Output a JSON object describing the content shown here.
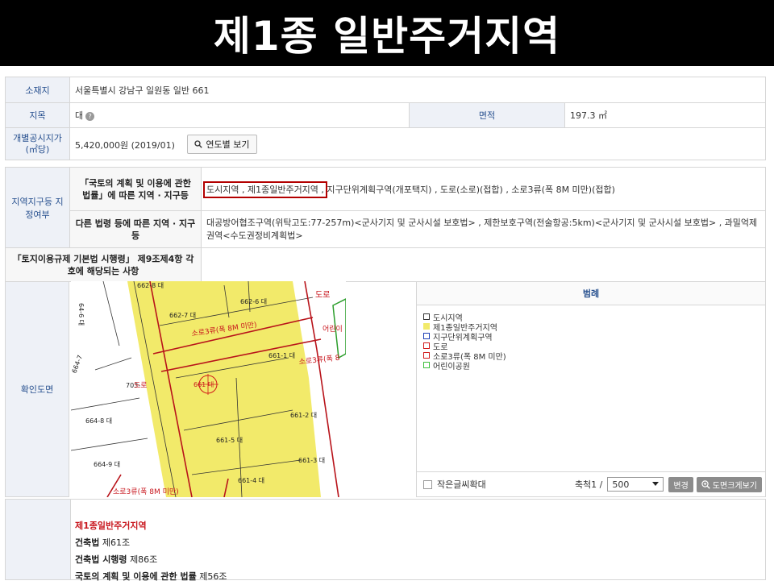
{
  "page": {
    "title": "제1종 일반주거지역"
  },
  "info": {
    "location_label": "소재지",
    "location_value": "서울특별시 강남구 일원동 일반 661",
    "jimok_label": "지목",
    "jimok_value": "대",
    "area_label": "면적",
    "area_value": "197.3 ㎡",
    "price_label": "개별공시지가(㎡당)",
    "price_value": "5,420,000원 (2019/01)",
    "price_button": "연도별 보기",
    "zone_label": "지역지구등 지정여부",
    "national_law_label": "「국토의 계획 및 이용에 관한 법률」에 따른 지역 · 지구등",
    "national_law_highlight": "도시지역 , 제1종일반주거지역 ,",
    "national_law_rest": "지구단위계획구역(개포택지) , 도로(소로)(접합) , 소로3류(폭 8M 미만)(접합)",
    "other_law_label": "다른 법령 등에 따른 지역 · 지구등",
    "other_law_value": "대공방어협조구역(위탁고도:77-257m)<군사기지 및 군사시설 보호법> , 제한보호구역(전술항공:5km)<군사기지 및 군사시설 보호법> , 과밀억제권역<수도권정비계획법>",
    "regulation_label": "「토지이용규제 기본법 시행령」 제9조제4항 각 호에 해당되는 사항",
    "regulation_value": ""
  },
  "map": {
    "section_label": "확인도면",
    "labels": {
      "p6628": "662-8 대",
      "p6627": "662-7 대",
      "p6626": "662-6 대",
      "road_top": "도로",
      "road_small1": "소로3류(폭 8M 미만)",
      "child_park": "어린이",
      "p6611": "661-1 대",
      "road_small2": "소로3류(폭 8",
      "p6647": "664-7",
      "p703": "703-",
      "road_do": "도로",
      "center": "661 대",
      "p6612": "661-2 대",
      "p6648": "664-8 대",
      "p6615": "661-5 대",
      "p6649": "664-9 대",
      "p6613": "661-3 대",
      "p6614": "661-4 대",
      "road_bottom": "소로3류(폭 8M 미만)",
      "side_64": "64-6 대"
    }
  },
  "legend": {
    "title": "범례",
    "items": [
      {
        "label": "도시지역",
        "color": "#ffffff",
        "border": "#333333"
      },
      {
        "label": "제1종일반주거지역",
        "color": "#f2ea6a",
        "border": "#f2ea6a"
      },
      {
        "label": "지구단위계획구역",
        "color": "#ffffff",
        "border": "#1e3fb5"
      },
      {
        "label": "도로",
        "color": "#ffffff",
        "border": "#d11a1a"
      },
      {
        "label": "소로3류(폭 8M 미만)",
        "color": "#ffffff",
        "border": "#d11a1a"
      },
      {
        "label": "어린이공원",
        "color": "#ffffff",
        "border": "#3bbf3b"
      }
    ],
    "small_text_label": "작은글씨확대",
    "scale_label": "축척1 /",
    "scale_value": "500",
    "change_button": "변경",
    "enlarge_button": "도면크게보기"
  },
  "laws": {
    "heading": "제1종일반주거지역",
    "items": [
      {
        "name": "건축법",
        "article": "제61조"
      },
      {
        "name": "건축법 시행령",
        "article": "제86조"
      },
      {
        "name": "국토의 계획 및 이용에 관한 법률",
        "article": "제56조"
      }
    ]
  }
}
